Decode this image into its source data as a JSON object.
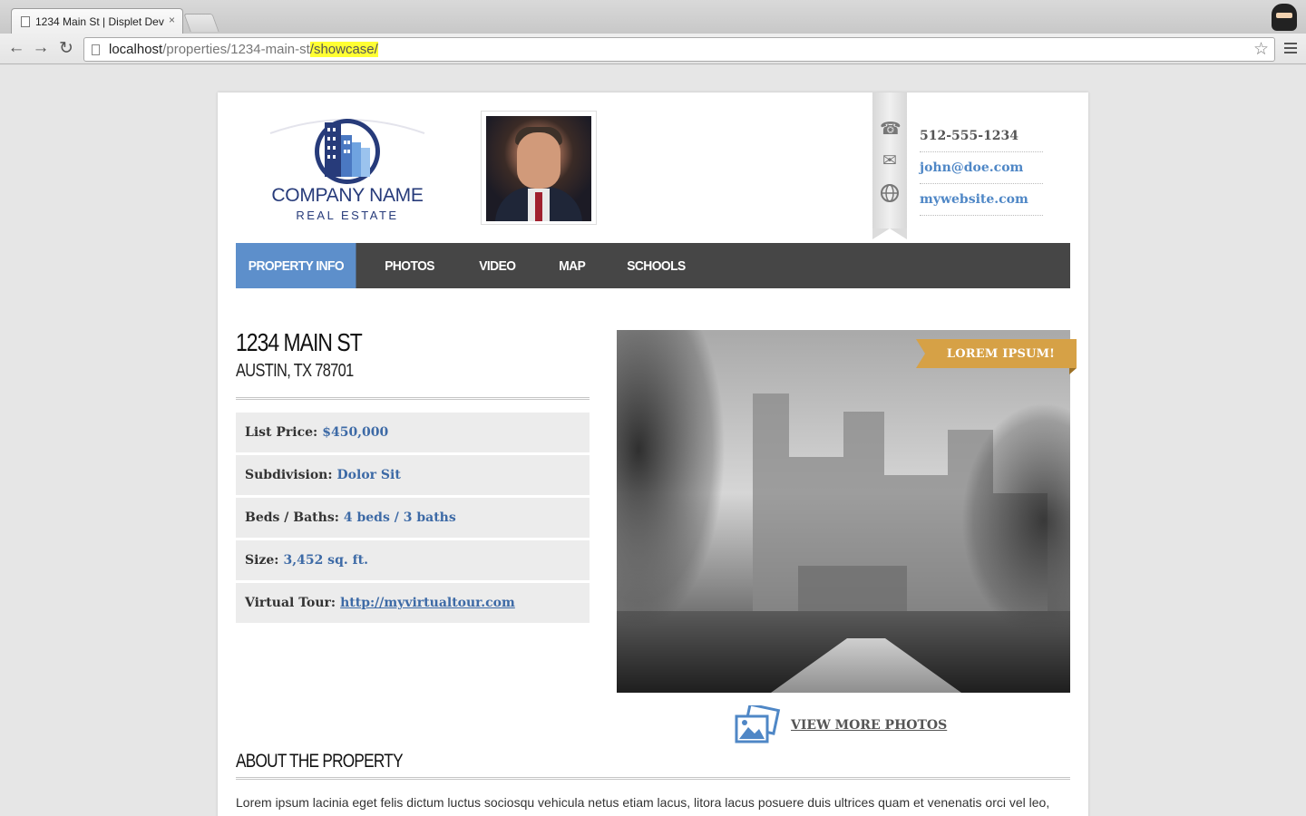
{
  "browser": {
    "tab_title": "1234 Main St | Displet Dev",
    "tab_close": "×",
    "url_host": "localhost",
    "url_path": "/properties/1234-main-st",
    "url_highlight": "/showcase/",
    "back_glyph": "←",
    "forward_glyph": "→",
    "reload_glyph": "↻",
    "star_glyph": "☆"
  },
  "header": {
    "logo_name": "COMPANY NAME",
    "logo_sub": "REAL ESTATE",
    "contact": {
      "phone": "512-555-1234",
      "email": "john@doe.com",
      "website": "mywebsite.com"
    },
    "icons": [
      "phone-icon",
      "mail-icon",
      "globe-icon"
    ]
  },
  "nav": {
    "items": [
      "PROPERTY INFO",
      "PHOTOS",
      "VIDEO",
      "MAP",
      "SCHOOLS"
    ],
    "active": "PROPERTY INFO"
  },
  "property": {
    "address": "1234 MAIN ST",
    "city": "AUSTIN, TX 78701",
    "facts": [
      {
        "label": "List Price:",
        "value": "$450,000"
      },
      {
        "label": "Subdivision:",
        "value": "Dolor Sit"
      },
      {
        "label": "Beds / Baths:",
        "value": "4 beds / 3 baths"
      },
      {
        "label": "Size:",
        "value": "3,452 sq. ft."
      },
      {
        "label": "Virtual Tour:",
        "value": "http://myvirtualtour.com"
      }
    ],
    "badge": "LOREM IPSUM!",
    "view_more": "VIEW MORE PHOTOS"
  },
  "about": {
    "heading": "ABOUT THE PROPERTY",
    "text": "Lorem ipsum lacinia eget felis dictum luctus sociosqu vehicula netus etiam lacus, litora lacus posuere duis ultrices quam et venenatis orci vel leo,"
  },
  "colors": {
    "nav_bg": "#464646",
    "nav_active": "#5d8fcb",
    "link": "#3d6aa6",
    "badge": "#d6a146",
    "logo": "#273b7a"
  }
}
